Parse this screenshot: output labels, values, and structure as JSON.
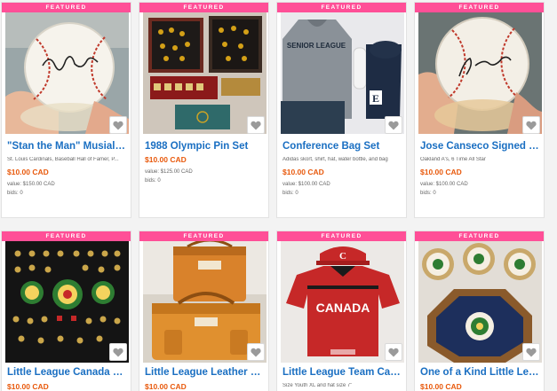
{
  "accent_color": "#ff4f97",
  "title_color": "#1a6fc2",
  "price_color": "#e8590c",
  "heart_icon": "heart-icon",
  "items": [
    {
      "badge": "FEATURED",
      "title": "\"Stan the Man\" Musial Si...",
      "desc": "St. Louis Cardinals, Baseball Hall of Famer, P...",
      "price": "$10.00 CAD",
      "value": "value: $150.00 CAD",
      "bids": "bids: 0"
    },
    {
      "badge": "FEATURED",
      "title": "1988 Olympic Pin Set",
      "desc": "",
      "price": "$10.00 CAD",
      "value": "value: $125.00 CAD",
      "bids": "bids: 0"
    },
    {
      "badge": "FEATURED",
      "title": "Conference Bag Set",
      "desc": "Adidas skort, shirt, hat, water bottle, and bag",
      "price": "$10.00 CAD",
      "value": "value: $100.00 CAD",
      "bids": "bids: 0"
    },
    {
      "badge": "FEATURED",
      "title": "Jose Canseco Signed Base...",
      "desc": "Oakland A's, 6 Time All Star",
      "price": "$10.00 CAD",
      "value": "value: $100.00 CAD",
      "bids": "bids: 0"
    },
    {
      "badge": "FEATURED",
      "title": "Little League Canada Pin ...",
      "desc": "",
      "price": "$10.00 CAD",
      "value": "",
      "bids": ""
    },
    {
      "badge": "FEATURED",
      "title": "Little League Leather Lug...",
      "desc": "",
      "price": "$10.00 CAD",
      "value": "",
      "bids": ""
    },
    {
      "badge": "FEATURED",
      "title": "Little League Team Cana...",
      "desc": "Size Youth XL and hat size 7\"",
      "price": "$10.00 CAD",
      "value": "",
      "bids": ""
    },
    {
      "badge": "FEATURED",
      "title": "One of a Kind Little Leag...",
      "desc": "",
      "price": "$10.00 CAD",
      "value": "",
      "bids": ""
    }
  ],
  "image_text": {
    "hoodie": "SENIOR LEAGUE",
    "jersey": "CANADA",
    "bag_letter": "E",
    "cap_letter": "C"
  }
}
